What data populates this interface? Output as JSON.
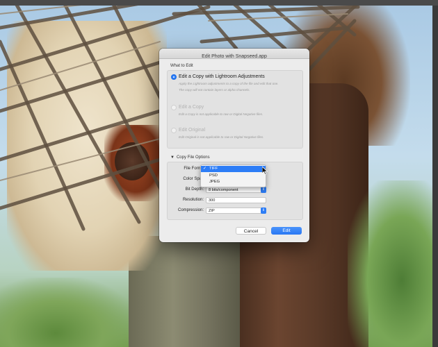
{
  "dialog": {
    "title": "Edit Photo with Snapseed.app",
    "what_to_edit_label": "What to Edit",
    "options": [
      {
        "label": "Edit a Copy with Lightroom Adjustments",
        "selected": true,
        "enabled": true,
        "description_lines": [
          "Apply the Lightroom adjustments to a copy of the file and edit that one.",
          "The copy will not contain layers or alpha channels."
        ]
      },
      {
        "label": "Edit a Copy",
        "selected": false,
        "enabled": false,
        "description_lines": [
          "Edit a Copy is not applicable to raw or Digital Negative files."
        ]
      },
      {
        "label": "Edit Original",
        "selected": false,
        "enabled": false,
        "description_lines": [
          "Edit Original is not applicable to raw or Digital Negative files."
        ]
      }
    ],
    "copy_file_options": {
      "label": "Copy File Options",
      "expanded": true,
      "file_format_label": "File Forma",
      "color_space_label": "Color Spac",
      "bit_depth_label": "Bit Depth:",
      "bit_depth_value": "8 bits/component",
      "resolution_label": "Resolution:",
      "resolution_value": "300",
      "compression_label": "Compression:",
      "compression_value": "ZIP"
    },
    "cancel_label": "Cancel",
    "edit_label": "Edit"
  },
  "format_dropdown": {
    "open": true,
    "items": [
      {
        "label": "TIFF",
        "selected": true,
        "check": "✓"
      },
      {
        "label": "PSD",
        "selected": false,
        "check": ""
      },
      {
        "label": "JPEG",
        "selected": false,
        "check": ""
      }
    ]
  },
  "colors": {
    "accent": "#2d7df6",
    "dialog_bg": "#ececec"
  }
}
